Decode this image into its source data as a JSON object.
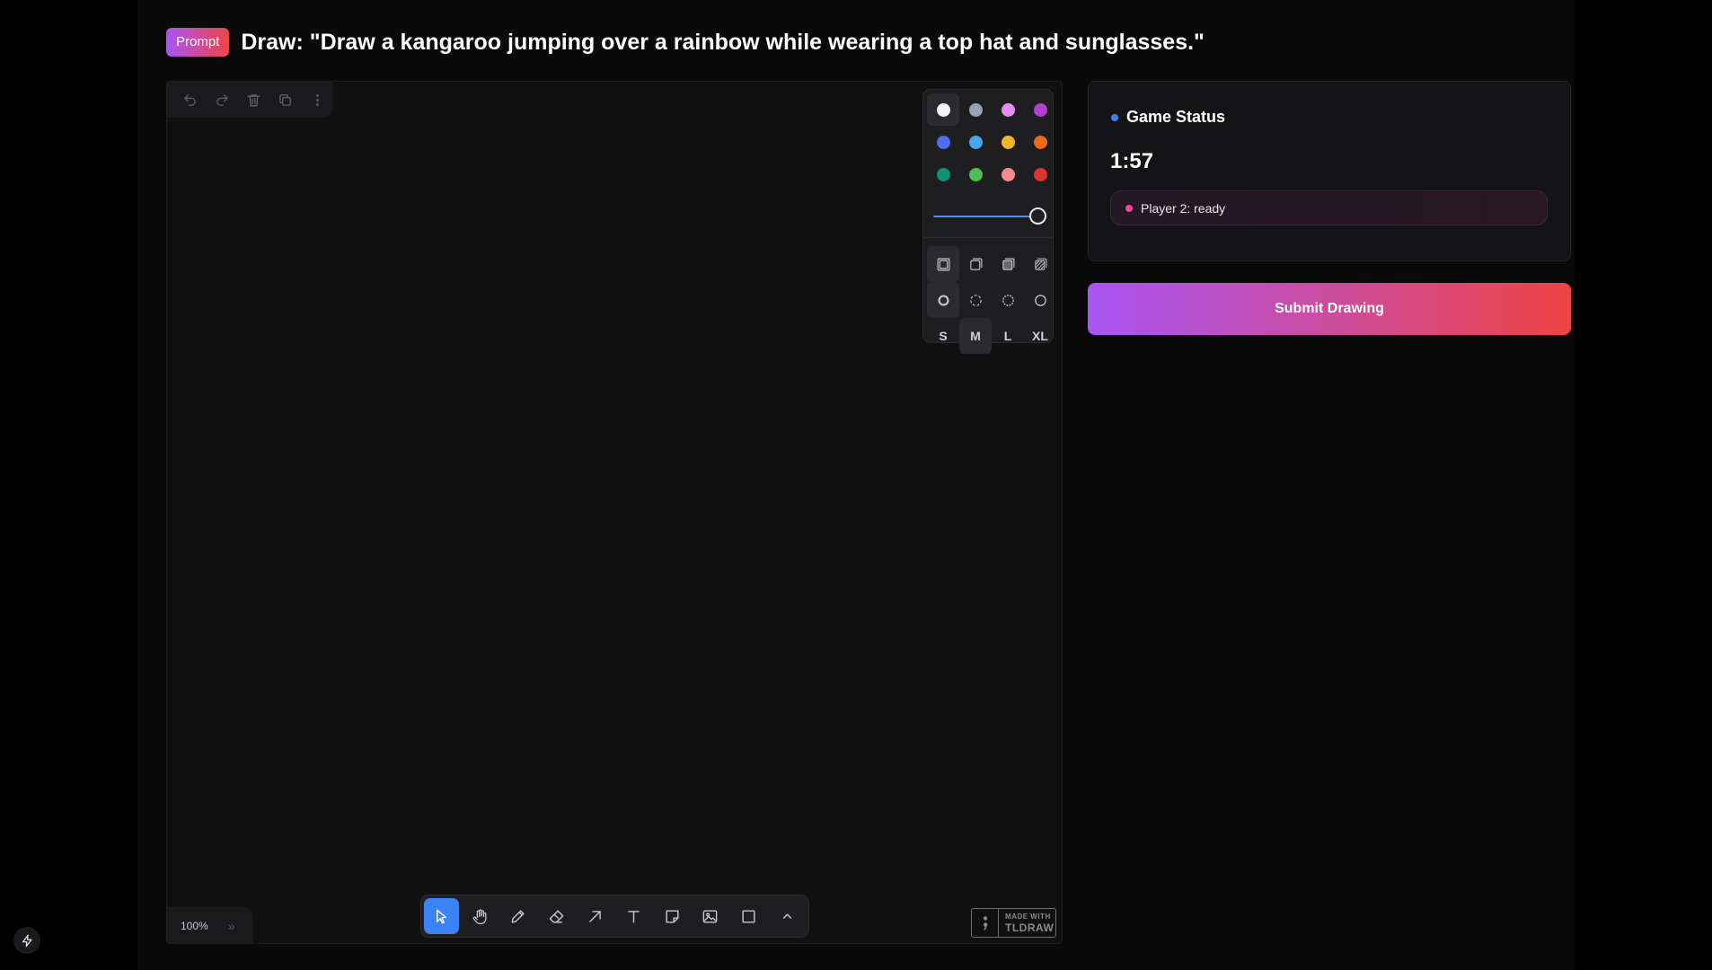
{
  "header": {
    "badge_label": "Prompt",
    "prompt_text": "Draw: \"Draw a kangaroo jumping over a rainbow while wearing a top hat and sunglasses.\""
  },
  "canvas": {
    "top_actions": [
      "undo-icon",
      "redo-icon",
      "trash-icon",
      "duplicate-icon",
      "more-vertical-icon"
    ],
    "style_panel": {
      "colors": [
        {
          "name": "white",
          "hex": "#f2f2f2",
          "selected": true
        },
        {
          "name": "grey",
          "hex": "#9ca0b4"
        },
        {
          "name": "light-violet",
          "hex": "#e58cf0"
        },
        {
          "name": "violet",
          "hex": "#b13fd0"
        },
        {
          "name": "blue",
          "hex": "#4f6ef0"
        },
        {
          "name": "light-blue",
          "hex": "#48a6ef"
        },
        {
          "name": "yellow",
          "hex": "#f2b529"
        },
        {
          "name": "orange",
          "hex": "#ef6a14"
        },
        {
          "name": "green",
          "hex": "#0e9372"
        },
        {
          "name": "light-green",
          "hex": "#4cbe55"
        },
        {
          "name": "light-red",
          "hex": "#f58a8a"
        },
        {
          "name": "red",
          "hex": "#e03432"
        }
      ],
      "opacity": 1.0,
      "fill_options": [
        "fill-none-icon",
        "fill-semi-icon",
        "fill-solid-icon",
        "fill-pattern-icon"
      ],
      "dash_options": [
        "dash-draw-icon",
        "dash-dashed-icon",
        "dash-dotted-icon",
        "dash-solid-icon"
      ],
      "sizes": [
        "S",
        "M",
        "L",
        "XL"
      ],
      "selected_size": "M"
    },
    "zoom_label": "100%",
    "tools": [
      "select-icon",
      "hand-icon",
      "draw-icon",
      "eraser-icon",
      "arrow-icon",
      "text-icon",
      "note-icon",
      "asset-icon",
      "rectangle-icon",
      "chevron-up-icon"
    ],
    "watermark": {
      "small": "MADE WITH",
      "big": "TLDRAW"
    }
  },
  "status": {
    "title": "Game Status",
    "timer": "1:57",
    "player_status": "Player 2: ready"
  },
  "submit_label": "Submit Drawing"
}
